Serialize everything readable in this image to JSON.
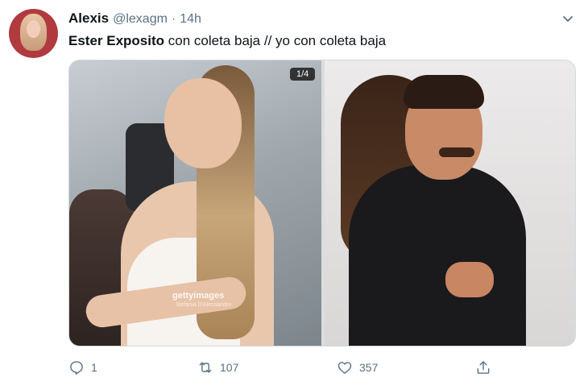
{
  "tweet": {
    "author_name": "Alexis",
    "author_handle": "@lexagm",
    "separator": "·",
    "time": "14h",
    "text_bold": "Ester Exposito",
    "text_rest": " con coleta baja // yo con coleta baja"
  },
  "media": {
    "counter": "1/4",
    "watermark": "gettyimages",
    "watermark_credit": "Stefania D'Alessandro"
  },
  "actions": {
    "reply_count": "1",
    "retweet_count": "107",
    "like_count": "357"
  },
  "icons": {
    "more": "chevron-down-icon",
    "reply": "reply-icon",
    "retweet": "retweet-icon",
    "like": "heart-icon",
    "share": "share-icon"
  },
  "colors": {
    "secondary_text": "#5b7083",
    "primary_text": "#0f1419"
  }
}
